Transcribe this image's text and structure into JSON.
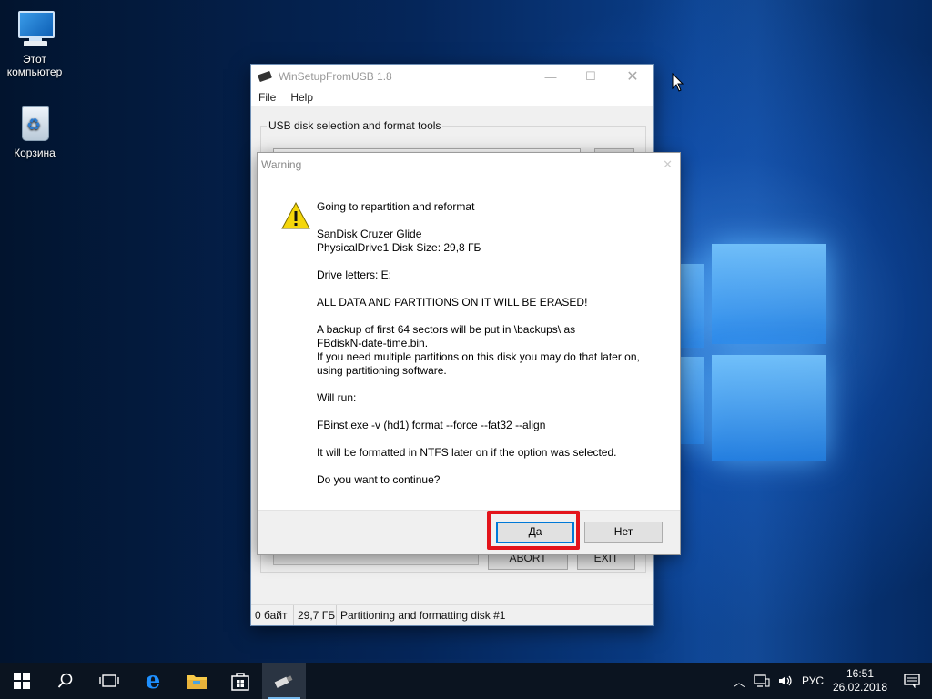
{
  "desktop": {
    "icons": [
      {
        "label": "Этот\nкомпьютер"
      },
      {
        "label": "Корзина"
      }
    ]
  },
  "main_window": {
    "title": "WinSetupFromUSB 1.8",
    "menu": [
      "File",
      "Help"
    ],
    "group_label": "USB disk selection and format tools",
    "abort_label": "ABORT",
    "exit_label": "EXIT",
    "status": {
      "free": "0 байт",
      "size": "29,7 ГБ",
      "message": "Partitioning and formatting disk #1"
    }
  },
  "dialog": {
    "title": "Warning",
    "lines": [
      "Going to repartition and reformat",
      "SanDisk Cruzer Glide\nPhysicalDrive1   Disk Size: 29,8 ГБ",
      "Drive letters:  E:",
      "ALL DATA AND PARTITIONS ON IT WILL BE ERASED!",
      "A backup of first 64 sectors will be put in \\backups\\ as\nFBdiskN-date-time.bin.\nIf you need multiple partitions on this disk you may do that later on,\nusing partitioning software.",
      "Will run:",
      "FBinst.exe -v (hd1) format --force  --fat32 --align",
      "It will be formatted in NTFS later on if the option was selected.",
      "Do you want to continue?"
    ],
    "yes_label": "Да",
    "no_label": "Нет"
  },
  "taskbar": {
    "language": "РУС",
    "time": "16:51",
    "date": "26.02.2018"
  },
  "colors": {
    "highlight": "#e3141b",
    "accent": "#0078d7",
    "taskbar": "#0b1420"
  }
}
